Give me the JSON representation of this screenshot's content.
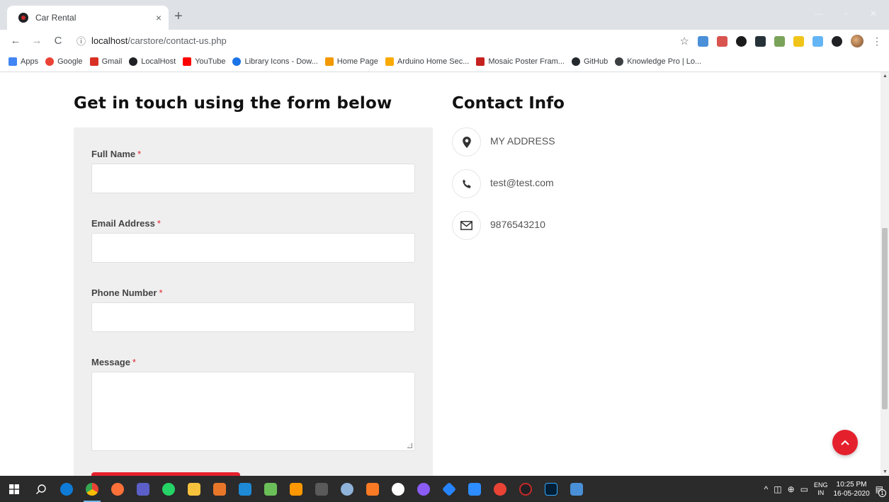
{
  "browser": {
    "tab_title": "Car Rental",
    "tab_close": "×",
    "new_tab": "+",
    "url_host": "localhost",
    "url_path": "/carstore/contact-us.php",
    "win_min": "—",
    "win_max": "▫",
    "win_close": "✕"
  },
  "bookmarks": [
    {
      "label": "Apps",
      "color": "#4285f4"
    },
    {
      "label": "Google",
      "color": "#ea4335"
    },
    {
      "label": "Gmail",
      "color": "#d93025"
    },
    {
      "label": "LocalHost",
      "color": "#202124"
    },
    {
      "label": "YouTube",
      "color": "#ff0000"
    },
    {
      "label": "Library Icons - Dow...",
      "color": "#1a73e8"
    },
    {
      "label": "Home Page",
      "color": "#f29900"
    },
    {
      "label": "Arduino Home Sec...",
      "color": "#f9ab00"
    },
    {
      "label": "Mosaic Poster Fram...",
      "color": "#c5221f"
    },
    {
      "label": "GitHub",
      "color": "#24292e"
    },
    {
      "label": "Knowledge Pro | Lo...",
      "color": "#3c4043"
    }
  ],
  "page": {
    "form_heading": "Get in touch using the form below",
    "contact_heading": "Contact Info",
    "fields": [
      {
        "label": "Full Name",
        "required": "*"
      },
      {
        "label": "Email Address",
        "required": "*"
      },
      {
        "label": "Phone Number",
        "required": "*"
      },
      {
        "label": "Message",
        "required": "*"
      }
    ],
    "contact": {
      "address": "MY ADDRESS",
      "email": "test@test.com",
      "phone": "9876543210"
    },
    "accent_color": "#e5202d"
  },
  "taskbar": {
    "lang_top": "ENG",
    "lang_bottom": "IN",
    "time": "10:25 PM",
    "date": "16-05-2020",
    "notification_count": "1",
    "apps": [
      {
        "name": "edge",
        "color": "#0f7bd6"
      },
      {
        "name": "chrome",
        "color": "#fbbc04",
        "active": true
      },
      {
        "name": "firefox",
        "color": "#ff7139"
      },
      {
        "name": "teams",
        "color": "#5b5fc7"
      },
      {
        "name": "whatsapp",
        "color": "#25d366"
      },
      {
        "name": "file-explorer",
        "color": "#f8c33c"
      },
      {
        "name": "snip",
        "color": "#e9772a"
      },
      {
        "name": "vscode",
        "color": "#1e8ad6"
      },
      {
        "name": "notepad",
        "color": "#6bbf59"
      },
      {
        "name": "sublime",
        "color": "#ff9800"
      },
      {
        "name": "terminal",
        "color": "#5a5a5a"
      },
      {
        "name": "paint",
        "color": "#8fb3d9"
      },
      {
        "name": "xampp",
        "color": "#fb7a24"
      },
      {
        "name": "github",
        "color": "#ffffff"
      },
      {
        "name": "obs",
        "color": "#8b5cf6"
      },
      {
        "name": "sourcetree",
        "color": "#2684ff"
      },
      {
        "name": "zoom",
        "color": "#2d8cff"
      },
      {
        "name": "gmail",
        "color": "#ea4335"
      },
      {
        "name": "localhost",
        "color": "#202124"
      },
      {
        "name": "photoshop",
        "color": "#31a8ff"
      },
      {
        "name": "ime",
        "color": "#4a90d9"
      }
    ]
  }
}
